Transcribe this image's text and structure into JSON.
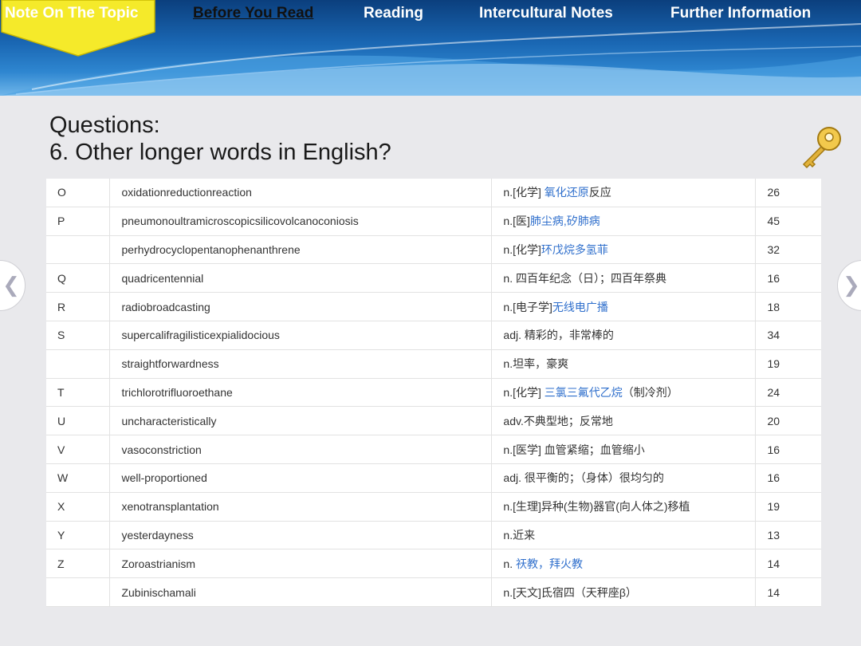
{
  "nav": {
    "items": [
      "Note On The Topic",
      "Before You Read",
      "Reading",
      "Intercultural Notes",
      "Further Information"
    ],
    "active_index": 1
  },
  "content": {
    "heading": "Questions:",
    "question": "6. Other longer words in English?"
  },
  "table": {
    "rows": [
      {
        "letter": "O",
        "word": "oxidationreductionreaction",
        "meaning_plain": "n.[化学] ",
        "meaning_blue": "氧化还原",
        "meaning_rest": "反应",
        "length": "26"
      },
      {
        "letter": "P",
        "word": "pneumonoultramicroscopicsilicovolcanoconiosis",
        "meaning_plain": "n.[医]",
        "meaning_blue": "肺尘病,矽肺病",
        "meaning_rest": "",
        "length": "45"
      },
      {
        "letter": "",
        "word": "perhydrocyclopentanophenanthrene",
        "meaning_plain": "n.[化学]",
        "meaning_blue": "环戊烷多氢菲",
        "meaning_rest": "",
        "length": "32"
      },
      {
        "letter": "Q",
        "word": "quadricentennial",
        "meaning_plain": "n. 四百年纪念（日）；四百年祭典",
        "meaning_blue": "",
        "meaning_rest": "",
        "length": "16"
      },
      {
        "letter": "R",
        "word": "radiobroadcasting",
        "meaning_plain": "n.[电子学]",
        "meaning_blue": "无线电广播",
        "meaning_rest": "",
        "length": "18"
      },
      {
        "letter": "S",
        "word": "supercalifragilisticexpialidocious",
        "meaning_plain": "adj. 精彩的，非常棒的",
        "meaning_blue": "",
        "meaning_rest": "",
        "length": "34"
      },
      {
        "letter": "",
        "word": "straightforwardness",
        "meaning_plain": "n.坦率，豪爽",
        "meaning_blue": "",
        "meaning_rest": "",
        "length": "19"
      },
      {
        "letter": "T",
        "word": "trichlorotrifluoroethane",
        "meaning_plain": "n.[化学] ",
        "meaning_blue": "三氯三氟代乙烷",
        "meaning_rest": "（制冷剂）",
        "length": "24"
      },
      {
        "letter": "U",
        "word": "uncharacteristically",
        "meaning_plain": "adv.不典型地；反常地",
        "meaning_blue": "",
        "meaning_rest": "",
        "length": "20"
      },
      {
        "letter": "V",
        "word": "vasoconstriction",
        "meaning_plain": "n.[医学] 血管紧缩；血管缩小",
        "meaning_blue": "",
        "meaning_rest": "",
        "length": "16"
      },
      {
        "letter": "W",
        "word": "well-proportioned",
        "meaning_plain": "adj. 很平衡的；（身体）很均匀的",
        "meaning_blue": "",
        "meaning_rest": "",
        "length": "16"
      },
      {
        "letter": "X",
        "word": "xenotransplantation",
        "meaning_plain": "n.[生理]异种(生物)器官(向人体之)移植",
        "meaning_blue": "",
        "meaning_rest": "",
        "length": "19"
      },
      {
        "letter": "Y",
        "word": "yesterdayness",
        "meaning_plain": "n.近来",
        "meaning_blue": "",
        "meaning_rest": "",
        "length": "13"
      },
      {
        "letter": "Z",
        "word": "Zoroastrianism",
        "meaning_plain": "n. ",
        "meaning_blue": "祆教，拜火教",
        "meaning_rest": "",
        "length": "14"
      },
      {
        "letter": "",
        "word": "Zubinischamali",
        "meaning_plain": "n.[天文]氐宿四（天秤座β）",
        "meaning_blue": "",
        "meaning_rest": "",
        "length": "14"
      }
    ]
  },
  "icons": {
    "key": "key-icon",
    "prev": "chevron-left-icon",
    "next": "chevron-right-icon"
  },
  "colors": {
    "header_dark": "#0b3f7d",
    "active_tab": "#f5ea2a",
    "link_blue": "#2f6fcc"
  }
}
